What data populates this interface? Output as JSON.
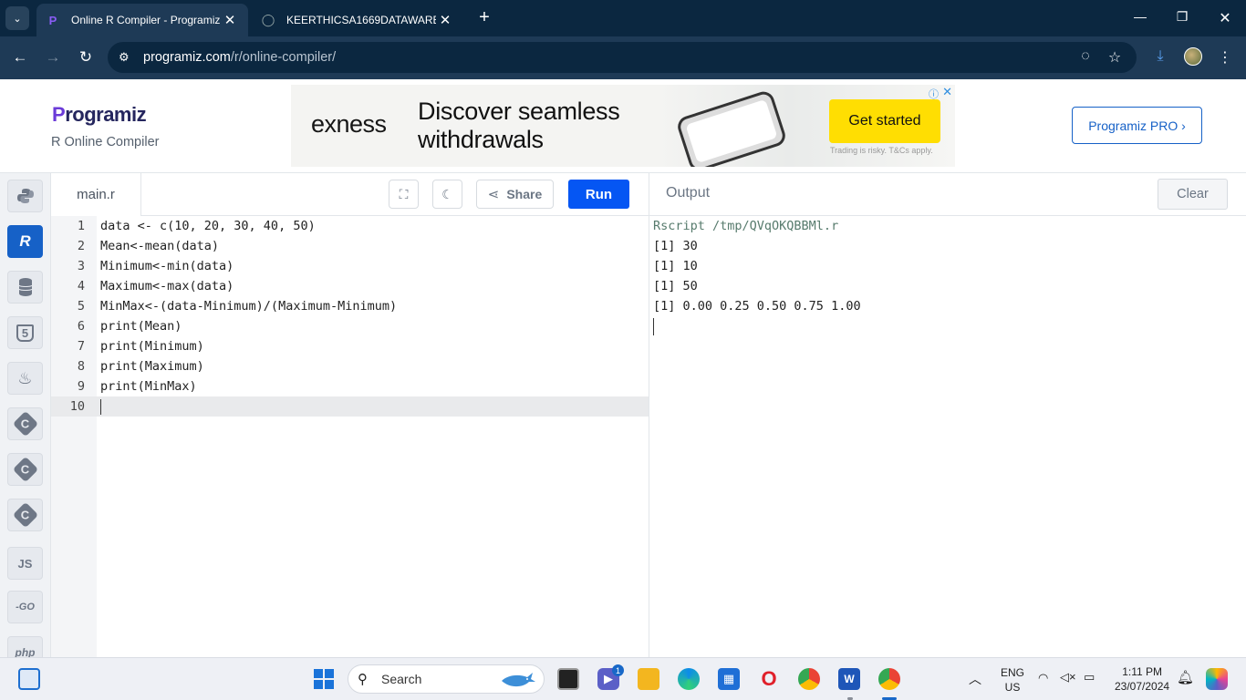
{
  "browser": {
    "tabs": [
      {
        "title": "Online R Compiler - Programiz",
        "active": true
      },
      {
        "title": "KEERTHICSA1669DATAWAREHO",
        "active": false
      }
    ],
    "address": {
      "domain": "programiz.com",
      "path": "/r/online-compiler/"
    }
  },
  "site": {
    "logo_text": "Programiz",
    "subtitle": "R Online Compiler",
    "pro_button": "Programiz PRO ›",
    "ad": {
      "brand": "exness",
      "headline": "Discover seamless withdrawals",
      "cta": "Get started",
      "disclaimer": "Trading is risky. T&Cs apply."
    }
  },
  "sidebar": {
    "languages": [
      {
        "name": "python-icon",
        "label": "",
        "active": false
      },
      {
        "name": "r-icon",
        "label": "R",
        "active": true
      },
      {
        "name": "sql-icon",
        "label": "",
        "active": false
      },
      {
        "name": "html-icon",
        "label": "5",
        "active": false
      },
      {
        "name": "java-icon",
        "label": "",
        "active": false
      },
      {
        "name": "c-icon",
        "label": "C",
        "active": false
      },
      {
        "name": "cpp-icon",
        "label": "C",
        "active": false
      },
      {
        "name": "csharp-icon",
        "label": "C",
        "active": false
      },
      {
        "name": "js-icon",
        "label": "JS",
        "active": false
      },
      {
        "name": "go-icon",
        "label": "-GO",
        "active": false
      },
      {
        "name": "php-icon",
        "label": "php",
        "active": false
      }
    ]
  },
  "editor": {
    "file_tab": "main.r",
    "share_label": "Share",
    "run_label": "Run",
    "current_line": 10,
    "lines": [
      "data <- c(10, 20, 30, 40, 50)",
      "Mean<-mean(data)",
      "Minimum<-min(data)",
      "Maximum<-max(data)",
      "MinMax<-(data-Minimum)/(Maximum-Minimum)",
      "print(Mean)",
      "print(Minimum)",
      "print(Maximum)",
      "print(MinMax)",
      ""
    ]
  },
  "output": {
    "title": "Output",
    "clear_label": "Clear",
    "command": "Rscript /tmp/QVqOKQBBMl.r",
    "lines": [
      "[1] 30",
      "[1] 10",
      "[1] 50",
      "[1] 0.00 0.25 0.50 0.75 1.00"
    ]
  },
  "taskbar": {
    "search_label": "Search",
    "teams_badge": "1",
    "language": {
      "line1": "ENG",
      "line2": "US"
    },
    "time": "1:11 PM",
    "date": "23/07/2024"
  },
  "colors": {
    "run": "#0556f3",
    "active_lang": "#1661c7",
    "tab_bar": "#0b2740",
    "toolbar": "#1e3a56"
  }
}
